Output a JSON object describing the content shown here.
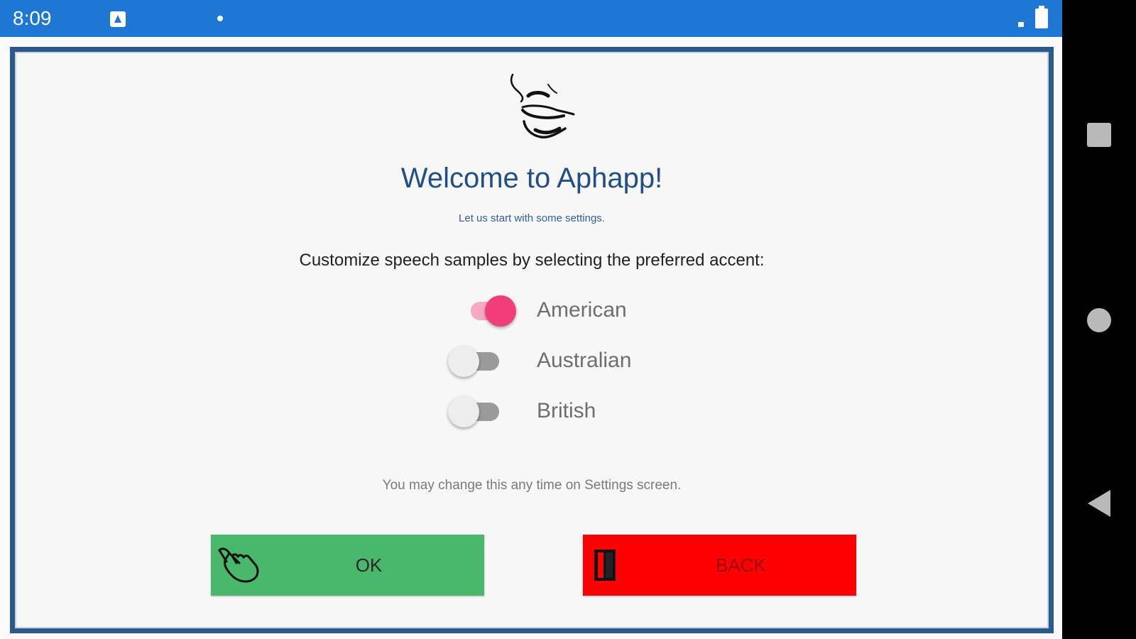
{
  "status_bar": {
    "time": "8:09",
    "notification_icon": "app-notification-icon",
    "background_color": "#1e77d2"
  },
  "nav_bar": {
    "recents_icon": "square-icon",
    "home_icon": "circle-icon",
    "back_icon": "triangle-back-icon"
  },
  "welcome": {
    "logo_icon": "face-profile-icon",
    "title": "Welcome to Aphapp!",
    "subtitle": "Let us start with some settings.",
    "prompt": "Customize speech samples by selecting the preferred accent:",
    "title_color": "#1f4f86"
  },
  "accents": [
    {
      "label": "American",
      "selected": true
    },
    {
      "label": "Australian",
      "selected": false
    },
    {
      "label": "British",
      "selected": false
    }
  ],
  "note": "You may change this any time on Settings screen.",
  "buttons": {
    "ok": {
      "label": "OK",
      "icon": "pointing-hand-icon",
      "color": "#4ab86a"
    },
    "back": {
      "label": "BACK",
      "icon": "exit-door-icon",
      "color": "#fe0000"
    }
  },
  "colors": {
    "frame_border": "#2c5a8c",
    "toggle_on": "#f03e7a"
  }
}
